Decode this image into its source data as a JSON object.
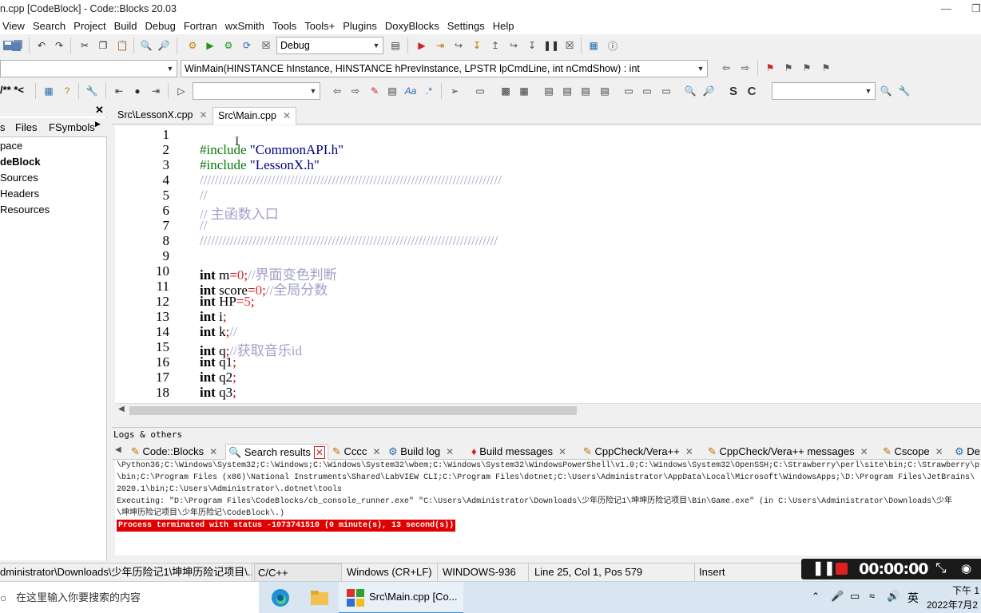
{
  "window": {
    "title": "n.cpp [CodeBlock] - Code::Blocks 20.03"
  },
  "menu": [
    "View",
    "Search",
    "Project",
    "Build",
    "Debug",
    "Fortran",
    "wxSmith",
    "Tools",
    "Tools+",
    "Plugins",
    "DoxyBlocks",
    "Settings",
    "Help"
  ],
  "toolbar": {
    "build_target": "Debug",
    "function_combo": "WinMain(HINSTANCE hInstance, HINSTANCE hPrevInstance, LPSTR lpCmdLine, int nCmdShow) : int",
    "comment_text": "/** *<",
    "search_value": ""
  },
  "left_panel": {
    "tabs": [
      "s",
      "Files",
      "FSymbols"
    ],
    "tree": [
      "pace",
      "deBlock",
      "Sources",
      "Headers",
      "Resources"
    ]
  },
  "editor": {
    "tabs": [
      {
        "label": "Src\\LessonX.cpp"
      },
      {
        "label": "Src\\Main.cpp"
      }
    ],
    "lines": [
      {
        "n": "1",
        "segs": []
      },
      {
        "n": "2",
        "segs": [
          {
            "t": "#include ",
            "c": "pp"
          },
          {
            "t": "\"CommonAPI.h\"",
            "c": "str"
          }
        ]
      },
      {
        "n": "3",
        "segs": [
          {
            "t": "#include ",
            "c": "pp"
          },
          {
            "t": "\"LessonX.h\"",
            "c": "str"
          }
        ]
      },
      {
        "n": "4",
        "segs": [
          {
            "t": "////////////////////////////////////////////////////////////////////////////////",
            "c": "cm"
          }
        ]
      },
      {
        "n": "5",
        "segs": [
          {
            "t": "//",
            "c": "cm"
          }
        ]
      },
      {
        "n": "6",
        "segs": [
          {
            "t": "// 主函数入口",
            "c": "cm"
          }
        ]
      },
      {
        "n": "7",
        "segs": [
          {
            "t": "//",
            "c": "cm"
          }
        ]
      },
      {
        "n": "8",
        "segs": [
          {
            "t": "///////////////////////////////////////////////////////////////////////////////",
            "c": "cm"
          }
        ]
      },
      {
        "n": "9",
        "segs": []
      },
      {
        "n": "10",
        "segs": [
          {
            "t": "int ",
            "c": "kw"
          },
          {
            "t": "m",
            "c": "idf"
          },
          {
            "t": "=",
            "c": "op"
          },
          {
            "t": "0",
            "c": "num"
          },
          {
            "t": ";",
            "c": "op"
          },
          {
            "t": "//界面变色判断",
            "c": "cm"
          }
        ]
      },
      {
        "n": "11",
        "segs": [
          {
            "t": "int ",
            "c": "kw"
          },
          {
            "t": "score",
            "c": "idf"
          },
          {
            "t": "=",
            "c": "op"
          },
          {
            "t": "0",
            "c": "num"
          },
          {
            "t": ";",
            "c": "op"
          },
          {
            "t": "//全局分数",
            "c": "cm"
          }
        ]
      },
      {
        "n": "12",
        "segs": [
          {
            "t": "int ",
            "c": "kw"
          },
          {
            "t": "HP",
            "c": "idf"
          },
          {
            "t": "=",
            "c": "op"
          },
          {
            "t": "5",
            "c": "num"
          },
          {
            "t": ";",
            "c": "op"
          }
        ]
      },
      {
        "n": "13",
        "segs": [
          {
            "t": "int ",
            "c": "kw"
          },
          {
            "t": "i",
            "c": "idf"
          },
          {
            "t": ";",
            "c": "op"
          }
        ]
      },
      {
        "n": "14",
        "segs": [
          {
            "t": "int ",
            "c": "kw"
          },
          {
            "t": "k",
            "c": "idf"
          },
          {
            "t": ";",
            "c": "op"
          },
          {
            "t": "//",
            "c": "cm"
          }
        ]
      },
      {
        "n": "15",
        "segs": [
          {
            "t": "int ",
            "c": "kw"
          },
          {
            "t": "q",
            "c": "idf"
          },
          {
            "t": ";",
            "c": "op"
          },
          {
            "t": "//获取音乐id",
            "c": "cm"
          }
        ]
      },
      {
        "n": "16",
        "segs": [
          {
            "t": "int ",
            "c": "kw"
          },
          {
            "t": "q1",
            "c": "idf"
          },
          {
            "t": ";",
            "c": "op"
          }
        ]
      },
      {
        "n": "17",
        "segs": [
          {
            "t": "int ",
            "c": "kw"
          },
          {
            "t": "q2",
            "c": "idf"
          },
          {
            "t": ";",
            "c": "op"
          }
        ]
      },
      {
        "n": "18",
        "segs": [
          {
            "t": "int ",
            "c": "kw"
          },
          {
            "t": "q3",
            "c": "idf"
          },
          {
            "t": ";",
            "c": "op"
          }
        ]
      }
    ]
  },
  "logs": {
    "title": "Logs & others",
    "tabs": [
      "Code::Blocks",
      "Search results",
      "Cccc",
      "Build log",
      "Build messages",
      "CppCheck/Vera++",
      "CppCheck/Vera++ messages",
      "Cscope",
      "De"
    ],
    "lines": [
      "\\Python36;C:\\Windows\\System32;C:\\Windows;C:\\Windows\\System32\\wbem;C:\\Windows\\System32\\WindowsPowerShell\\v1.0;C:\\Windows\\System32\\OpenSSH;C:\\Strawberry\\perl\\site\\bin;C:\\Strawberry\\p",
      "\\bin;C:\\Program Files (x86)\\National Instruments\\Shared\\LabVIEW CLI;C:\\Program Files\\dotnet;C:\\Users\\Administrator\\AppData\\Local\\Microsoft\\WindowsApps;\\D:\\Program Files\\JetBrains\\",
      "2020.1\\bin;C:\\Users\\Administrator\\.dotnet\\tools",
      "Executing: \"D:\\Program Files\\CodeBlocks/cb_console_runner.exe\" \"C:\\Users\\Administrator\\Downloads\\少年历险记1\\坤坤历险记项目\\Bin\\Game.exe\"  (in C:\\Users\\Administrator\\Downloads\\少年",
      "\\坤坤历险记项目\\少年历险记\\CodeBlock\\.)"
    ],
    "error": "Process terminated with status -1073741510 (0 minute(s), 13 second(s))"
  },
  "status": {
    "path": "dministrator\\Downloads\\少年历险记1\\坤坤历险记项目\\...",
    "lang": "C/C++",
    "eol": "Windows (CR+LF)",
    "encoding": "WINDOWS-936",
    "position": "Line 25, Col 1, Pos 579",
    "mode": "Insert"
  },
  "recorder": {
    "time": "00:00:00"
  },
  "taskbar": {
    "search_placeholder": "在这里输入你要搜索的内容",
    "active_app": "Src\\Main.cpp [Co...",
    "ime": "英",
    "clock_ampm": "下午 1",
    "date": "2022年7月2"
  },
  "colors": {
    "error_bg": "#e00000",
    "comment": "#a0a0c8",
    "number": "#e03030",
    "preprocessor": "#0a7a0a"
  }
}
